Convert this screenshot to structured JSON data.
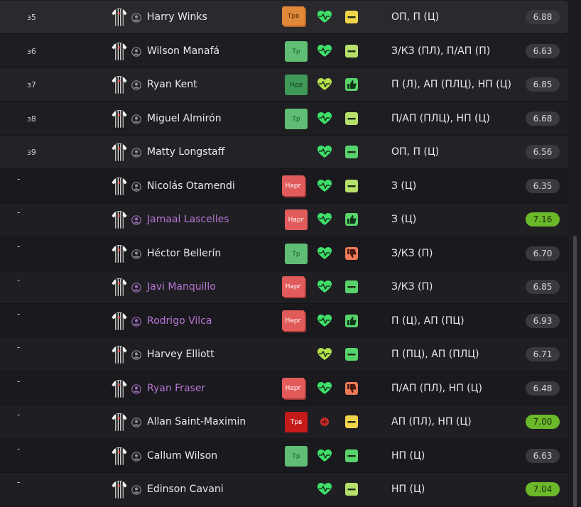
{
  "colors": {
    "loan_name": "#b676d6",
    "rating_high": "#6bb82a",
    "background": "#1c1b1f"
  },
  "players": [
    {
      "num": "з5",
      "name": "Harry Winks",
      "loan": false,
      "badge": {
        "text": "Трв",
        "style": "orange"
      },
      "fitness": "green",
      "condition": {
        "icon": "minus-icon",
        "color": "yellow"
      },
      "position": "ОП, П (Ц)",
      "rating": "6.88",
      "rating_high": false
    },
    {
      "num": "з6",
      "name": "Wilson Manafá",
      "loan": false,
      "badge": {
        "text": "Тр",
        "style": "green"
      },
      "fitness": "green",
      "condition": {
        "icon": "minus-icon",
        "color": "lime"
      },
      "position": "З/КЗ (ПЛ), П/АП (П)",
      "rating": "6.63",
      "rating_high": false
    },
    {
      "num": "з7",
      "name": "Ryan Kent",
      "loan": false,
      "badge": {
        "text": "Ндв",
        "style": "green2"
      },
      "fitness": "yellow-green",
      "condition": {
        "icon": "thumb-up-icon",
        "color": "green"
      },
      "position": "П (Л), АП (ПЛЦ), НП (Ц)",
      "rating": "6.85",
      "rating_high": false
    },
    {
      "num": "з8",
      "name": "Miguel Almirón",
      "loan": false,
      "badge": {
        "text": "Тр",
        "style": "green"
      },
      "fitness": "green",
      "condition": {
        "icon": "minus-icon",
        "color": "lime"
      },
      "position": "П/АП (ПЛЦ), НП (Ц)",
      "rating": "6.68",
      "rating_high": false
    },
    {
      "num": "з9",
      "name": "Matty Longstaff",
      "loan": false,
      "badge": null,
      "fitness": "green",
      "condition": {
        "icon": "minus-icon",
        "color": "green"
      },
      "position": "ОП, П (Ц)",
      "rating": "6.56",
      "rating_high": false
    },
    {
      "num": "-",
      "name": "Nicolás Otamendi",
      "loan": false,
      "badge": {
        "text": "Нарг",
        "style": "red"
      },
      "fitness": "green",
      "condition": {
        "icon": "minus-icon",
        "color": "lime"
      },
      "position": "З (Ц)",
      "rating": "6.35",
      "rating_high": false
    },
    {
      "num": "-",
      "name": "Jamaal Lascelles",
      "loan": true,
      "badge": {
        "text": "Нарг",
        "style": "red-solo"
      },
      "fitness": "green",
      "condition": {
        "icon": "thumb-up-icon",
        "color": "green"
      },
      "position": "З (Ц)",
      "rating": "7.16",
      "rating_high": true
    },
    {
      "num": "-",
      "name": "Héctor Bellerín",
      "loan": false,
      "badge": {
        "text": "Тр",
        "style": "green"
      },
      "fitness": "green",
      "condition": {
        "icon": "thumb-down-icon",
        "color": "orange"
      },
      "position": "З/КЗ (П)",
      "rating": "6.70",
      "rating_high": false
    },
    {
      "num": "-",
      "name": "Javi Manquillo",
      "loan": true,
      "badge": {
        "text": "Нарг",
        "style": "red"
      },
      "fitness": "green",
      "condition": {
        "icon": "minus-icon",
        "color": "green"
      },
      "position": "З/КЗ (П)",
      "rating": "6.85",
      "rating_high": false
    },
    {
      "num": "-",
      "name": "Rodrigo Vilca",
      "loan": true,
      "badge": {
        "text": "Нарг",
        "style": "red"
      },
      "fitness": "green",
      "condition": {
        "icon": "thumb-up-icon",
        "color": "green"
      },
      "position": "П (Ц), АП (ПЦ)",
      "rating": "6.93",
      "rating_high": false
    },
    {
      "num": "-",
      "name": "Harvey Elliott",
      "loan": false,
      "badge": null,
      "fitness": "yellow-green",
      "condition": {
        "icon": "minus-icon",
        "color": "green"
      },
      "position": "П (ПЦ), АП (ПЛЦ)",
      "rating": "6.71",
      "rating_high": false
    },
    {
      "num": "-",
      "name": "Ryan Fraser",
      "loan": true,
      "badge": {
        "text": "Нарг",
        "style": "red"
      },
      "fitness": "green",
      "condition": {
        "icon": "thumb-down-icon",
        "color": "orange"
      },
      "position": "П/АП (ПЛ), НП (Ц)",
      "rating": "6.48",
      "rating_high": false
    },
    {
      "num": "-",
      "name": "Allan Saint-Maximin",
      "loan": false,
      "badge": {
        "text": "Трв",
        "style": "darkred"
      },
      "fitness": "injured",
      "condition": {
        "icon": "minus-icon",
        "color": "yellow"
      },
      "position": "АП (ПЛ), НП (Ц)",
      "rating": "7.00",
      "rating_high": true
    },
    {
      "num": "-",
      "name": "Callum Wilson",
      "loan": false,
      "badge": {
        "text": "Тр",
        "style": "green"
      },
      "fitness": "green",
      "condition": {
        "icon": "minus-icon",
        "color": "green"
      },
      "position": "НП (Ц)",
      "rating": "6.63",
      "rating_high": false
    },
    {
      "num": "-",
      "name": "Edinson Cavani",
      "loan": false,
      "badge": null,
      "fitness": "green",
      "condition": {
        "icon": "minus-icon",
        "color": "lime"
      },
      "position": "НП (Ц)",
      "rating": "7.04",
      "rating_high": true
    }
  ]
}
